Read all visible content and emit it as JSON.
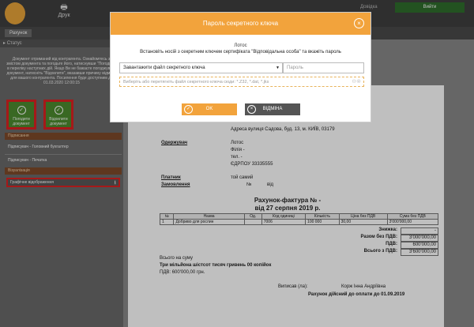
{
  "topbar": {
    "print_label": "Друк",
    "help_label": "Довідка",
    "exit_label": "Вийти"
  },
  "tabs": [
    {
      "label": "Рахунок"
    }
  ],
  "sidebar": {
    "status_label": "Статус",
    "note": "Документ отриманий від контрагента. Ознайомтесь зі змістом документа та погодьте його, натиснувши \"Погодити\" в переліку наступних дій. Якщо Ви не бажаєте погоджувати документ, натисніть \"Відхилити\", вказавши причину відмови для вашого контрагента. Посилення буде доступним до 01.03.2020 12:00:15",
    "approve_label": "Погодити документ",
    "reject_label": "Відхилити документ",
    "signatures_header": "Підписання",
    "signers": [
      "Підписувач - Головний бухгалтер",
      "Підписувач - Печатка"
    ],
    "visual_header": "Візуалізація",
    "graphic_label": "Графічне відображення"
  },
  "dialog": {
    "title": "Пароль секретного ключа",
    "org": "Лотос",
    "instruction": "Встановіть носій з секретним ключем сертифіката \"Відповідальна особа\" та вкажіть пароль",
    "select_value": "Завантажити файл секретного ключа",
    "password_placeholder": "Пароль",
    "file_hint": "Виберіть або перетягніть файл секретного ключа сюди: *.Z32, *.dat, *.jks",
    "ok_label": "OK",
    "cancel_label": "ВІДМІНА"
  },
  "document": {
    "address": "Адреса вулиця Садова, буд. 13, м. КИЇВ, 03179",
    "recipient_label": "Одержувач",
    "recipient_lines": [
      "Лотос",
      "Філія -",
      "тел. -",
      "ЄДРПОУ 33335555"
    ],
    "payer_label": "Платник",
    "order_label": "Замовлення",
    "payer_value": "той самий",
    "order_no": "№",
    "order_date": "від",
    "invoice_title": "Рахунок-фактура № -",
    "invoice_date": "від 27 серпня 2019 р.",
    "table_headers": [
      "№",
      "Назва",
      "Од.",
      "Код одиниці",
      "Кількість",
      "Ціна без ПДВ",
      "Сума без ПДВ"
    ],
    "table_rows": [
      [
        "1",
        "Добриво для рослин",
        "",
        "7006",
        "100 000",
        "30,00",
        "3'000'000,00"
      ]
    ],
    "discount_label": "Знижка:",
    "discount_value": "-",
    "total_no_vat_label": "Разом без ПДВ:",
    "total_no_vat": "3'000'000,00",
    "vat_label": "ПДВ:",
    "vat_value": "600'000,00",
    "total_vat_label": "Всього з ПДВ:",
    "total_vat": "3'600'000,00",
    "sum_label": "Всього на суму",
    "sum_words": "Три мільйона шістсот тисяч гривень 00 копійок",
    "sum_vat": "ПДВ: 600'000,00 грн.",
    "issued_label": "Виписав (ла):",
    "issued_name": "Корж Інна Андріївна",
    "valid_until": "Рахунок дійсний до оплати до 01.09.2019"
  }
}
